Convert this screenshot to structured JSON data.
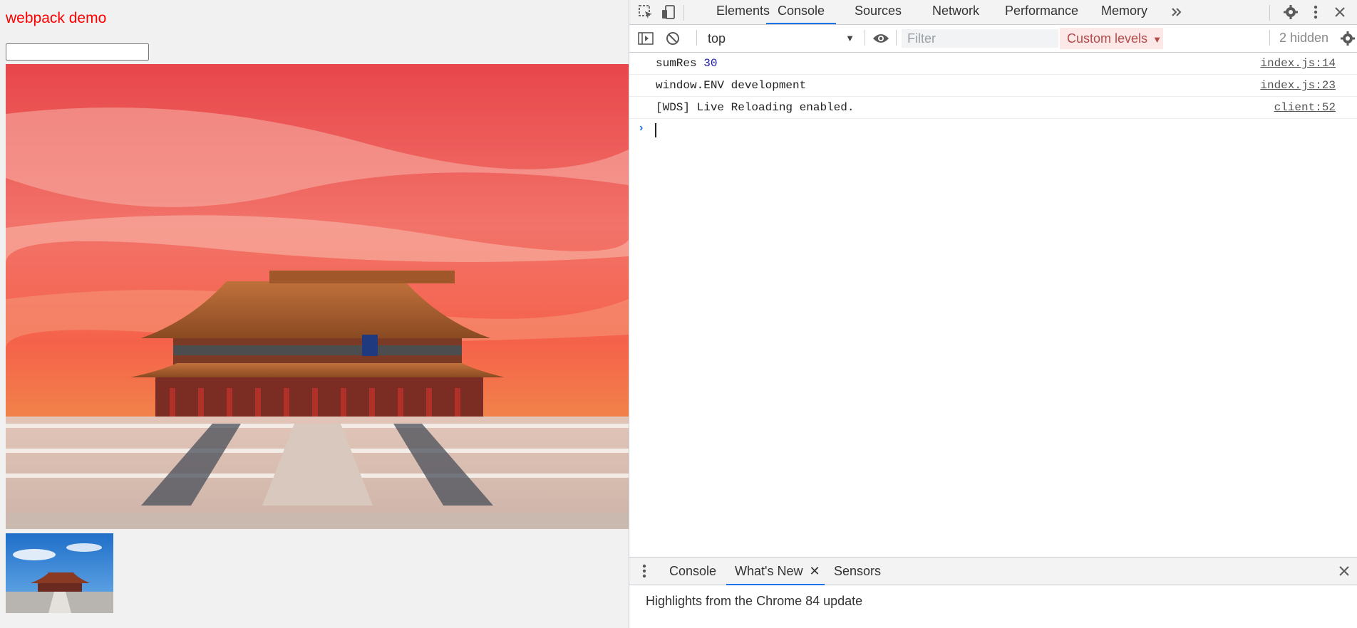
{
  "page": {
    "title": "webpack demo",
    "input_value": "",
    "title_color": "#ff0000"
  },
  "devtools": {
    "tabs": [
      "Elements",
      "Console",
      "Sources",
      "Network",
      "Performance",
      "Memory"
    ],
    "active_tab": "Console",
    "more_tabs_icon": "double-chevron-right",
    "context": "top",
    "filter_placeholder": "Filter",
    "levels_label": "Custom levels",
    "hidden_count": "2 hidden",
    "messages": [
      {
        "prefix": "sumRes ",
        "value": "30",
        "source": "index.js:14"
      },
      {
        "prefix": "window.ENV development",
        "value": "",
        "source": "index.js:23"
      },
      {
        "prefix": "[WDS] Live Reloading enabled.",
        "value": "",
        "source": "client:52"
      }
    ],
    "drawer_tabs": [
      "Console",
      "What's New",
      "Sensors"
    ],
    "drawer_active": "What's New",
    "drawer_text": "Highlights from the Chrome 84 update",
    "accent": "#1a73e8"
  }
}
